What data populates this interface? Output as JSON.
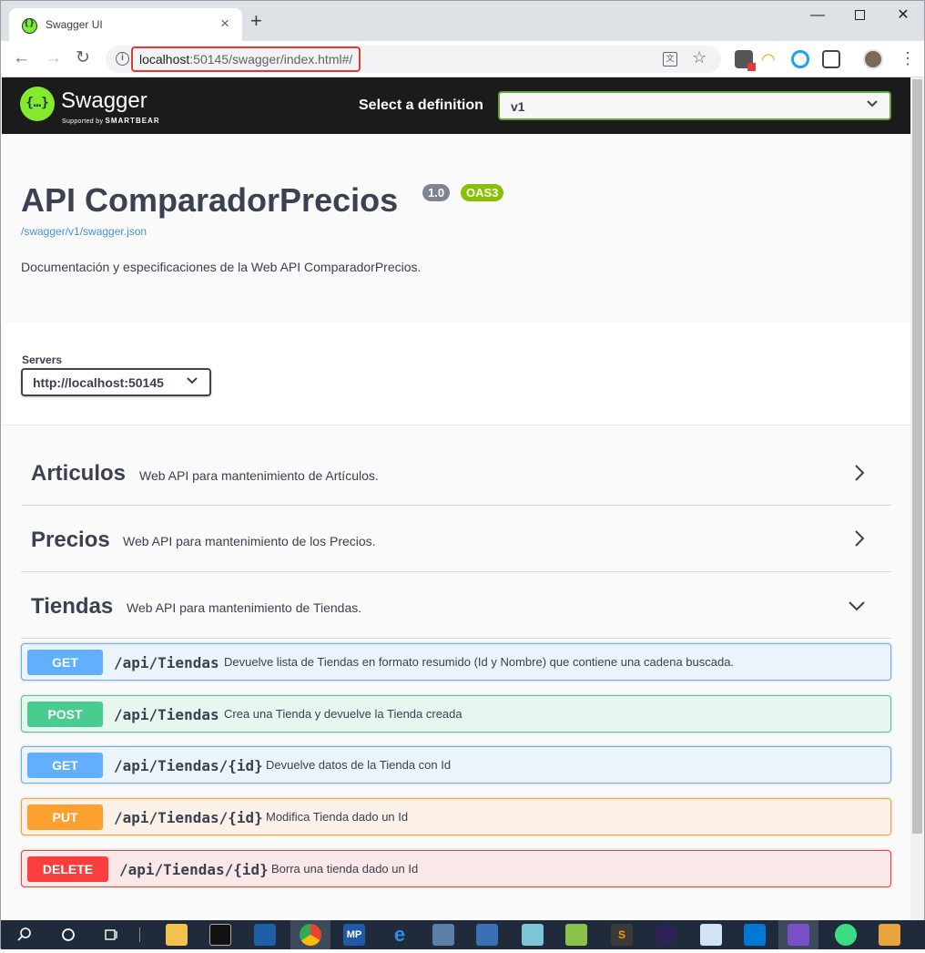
{
  "browser": {
    "tab_title": "Swagger UI",
    "tab_close": "×",
    "new_tab": "+",
    "url_host": "localhost",
    "url_rest": ":50145/swagger/index.html#/",
    "back": "←",
    "forward": "→",
    "reload": "↻",
    "info": "i",
    "translate": "文",
    "bookmark": "☆",
    "menu": "⋮",
    "minimize": "—",
    "close": "✕"
  },
  "swagger_bar": {
    "brand": "Swagger",
    "supported_by": "Supported by",
    "smartbear": "SMARTBEAR",
    "definition_label": "Select a definition",
    "definition_value": "v1",
    "logo_glyph": "{…}"
  },
  "info": {
    "title": "API ComparadorPrecios",
    "version": "1.0",
    "oas": "OAS3",
    "spec_url": "/swagger/v1/swagger.json",
    "description": "Documentación y especificaciones de la Web API ComparadorPrecios."
  },
  "servers": {
    "label": "Servers",
    "selected": "http://localhost:50145"
  },
  "tags": [
    {
      "name": "Articulos",
      "description": "Web API para mantenimiento de Artículos.",
      "expanded": false
    },
    {
      "name": "Precios",
      "description": "Web API para mantenimiento de los Precios.",
      "expanded": false
    },
    {
      "name": "Tiendas",
      "description": "Web API para mantenimiento de Tiendas.",
      "expanded": true
    }
  ],
  "operations": [
    {
      "method": "GET",
      "path": "/api/Tiendas",
      "summary": "Devuelve lista de Tiendas en formato resumido (Id y Nombre) que contiene una cadena buscada."
    },
    {
      "method": "POST",
      "path": "/api/Tiendas",
      "summary": "Crea una Tienda y devuelve la Tienda creada"
    },
    {
      "method": "GET",
      "path": "/api/Tiendas/{id}",
      "summary": "Devuelve datos de la Tienda con Id"
    },
    {
      "method": "PUT",
      "path": "/api/Tiendas/{id}",
      "summary": "Modifica Tienda dado un Id"
    },
    {
      "method": "DELETE",
      "path": "/api/Tiendas/{id}",
      "summary": "Borra una tienda dado un Id"
    }
  ],
  "taskbar": {
    "items": [
      "search-icon",
      "cortana-icon",
      "task-view-icon",
      "file-explorer-icon",
      "cmd-icon",
      "powershell-icon",
      "chrome-icon",
      "mp-icon",
      "edge-icon",
      "virtualbox-icon",
      "remote-desktop-icon",
      "notepad-icon",
      "notepadpp-icon",
      "sublime-icon",
      "eclipse-icon",
      "box-icon",
      "vscode-icon",
      "visual-studio-icon",
      "android-studio-icon",
      "cube-icon"
    ],
    "mp_label": "MP"
  }
}
